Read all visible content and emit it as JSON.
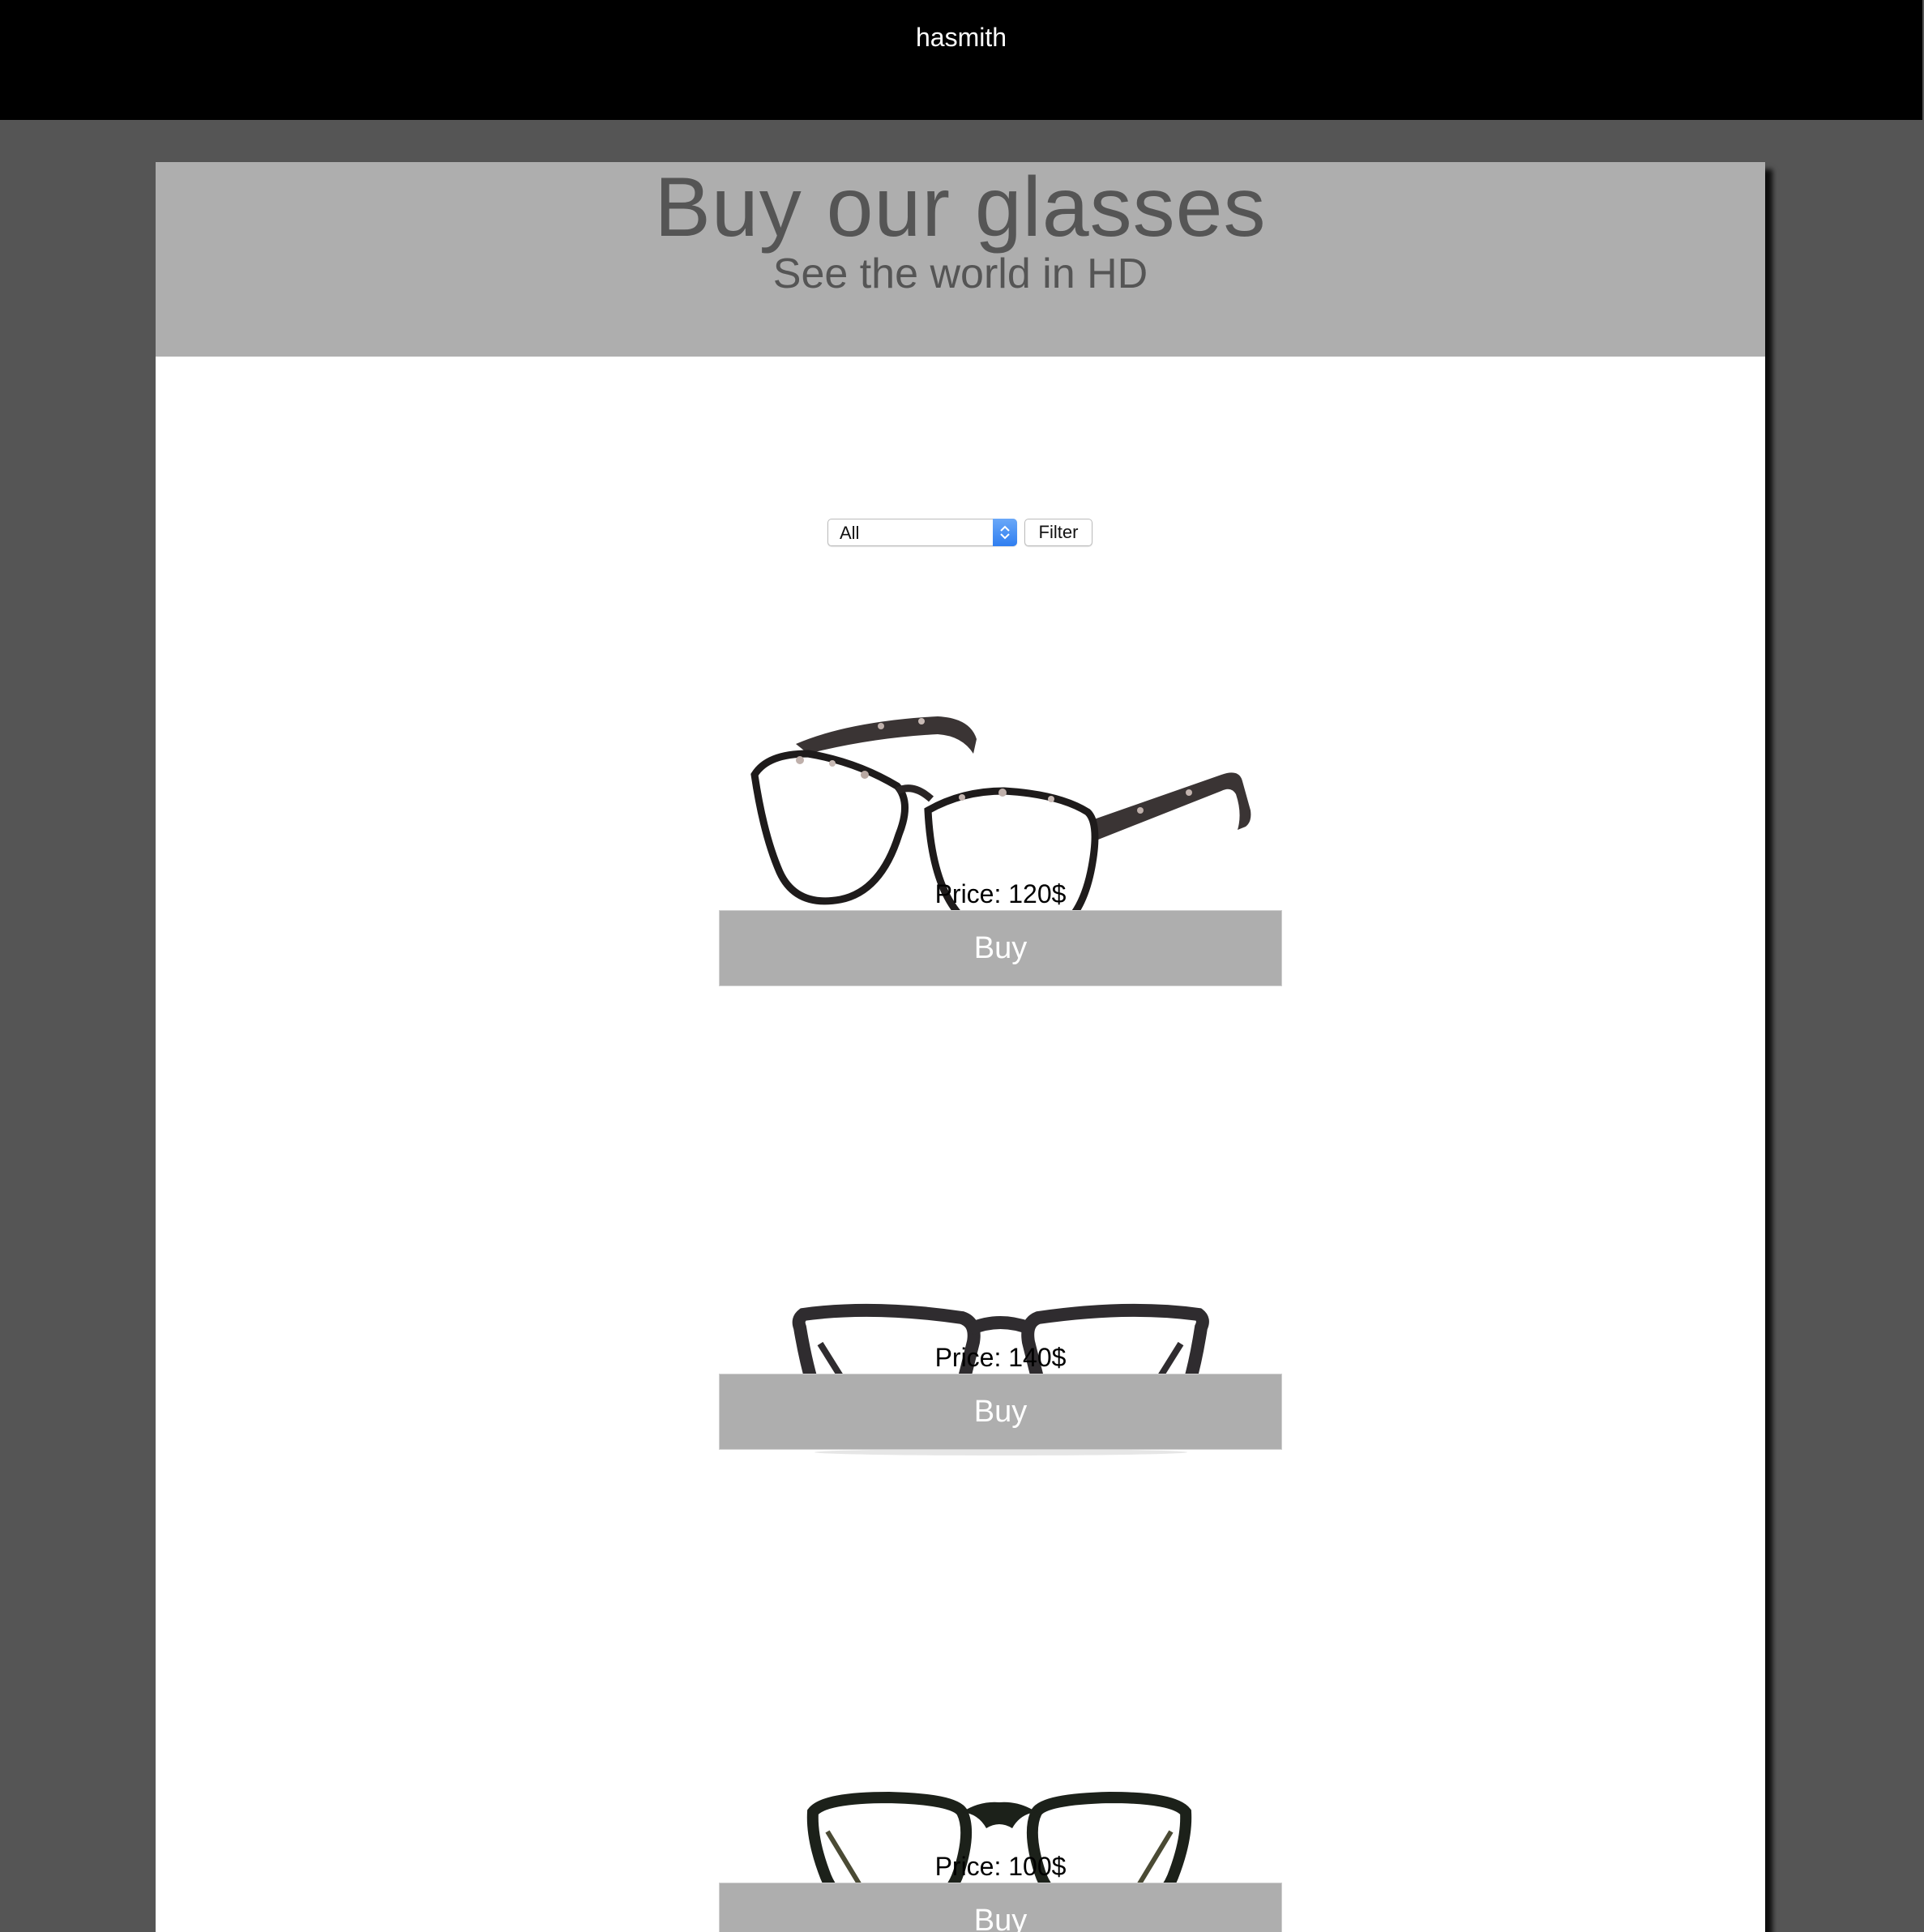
{
  "header": {
    "username": "hasmith"
  },
  "hero": {
    "title": "Buy our glasses",
    "subtitle": "See the world in HD"
  },
  "filter": {
    "selected": "All",
    "button_label": "Filter"
  },
  "products": [
    {
      "price_label": "Price: 120$",
      "buy_label": "Buy",
      "image": "tortoise-cat-eye-glasses"
    },
    {
      "price_label": "Price: 140$",
      "buy_label": "Buy",
      "image": "dark-rectangular-glasses"
    },
    {
      "price_label": "Price: 100$",
      "buy_label": "Buy",
      "image": "round-keyhole-glasses"
    }
  ],
  "colors": {
    "background": "#555555",
    "topbar": "#000000",
    "hero": "#aeaeae",
    "buy_button": "#aeaeae",
    "select_accent": "#2f7ef0"
  }
}
